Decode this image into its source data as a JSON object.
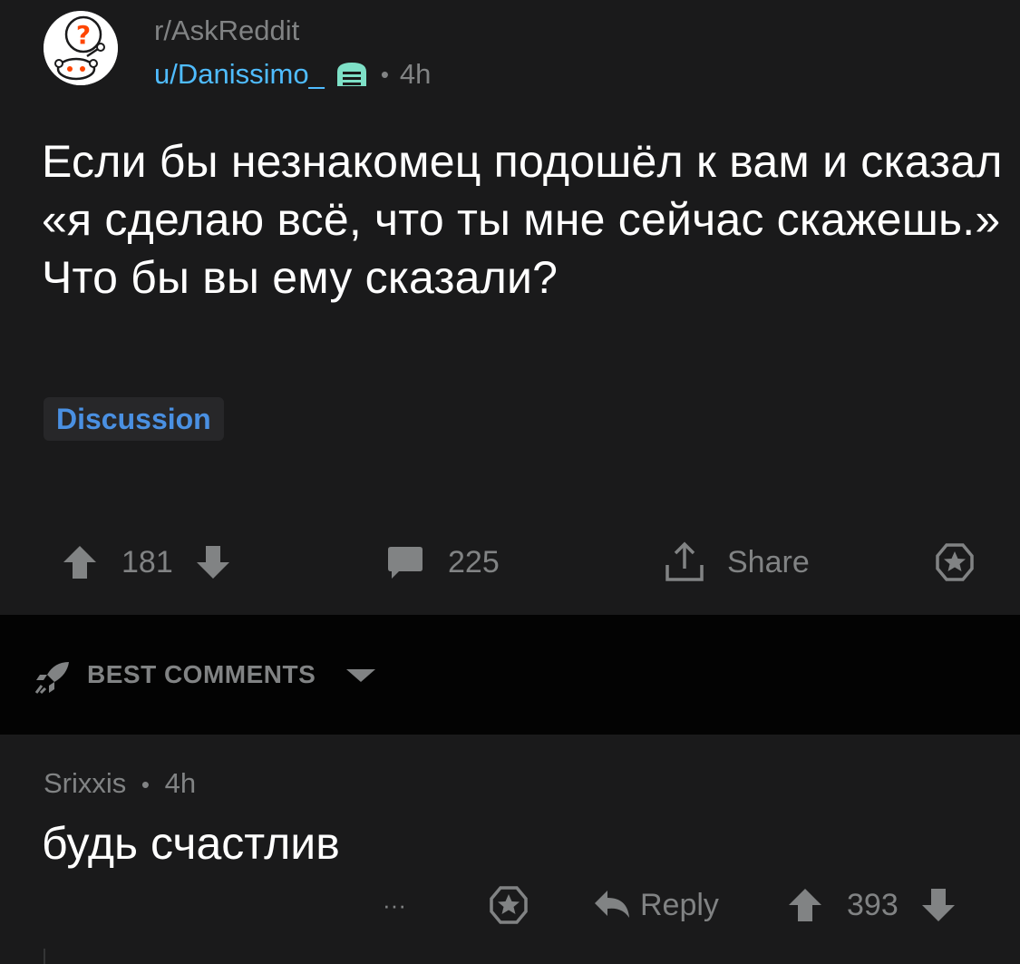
{
  "post": {
    "subreddit": "r/AskReddit",
    "username": "u/Danissimo_",
    "separator": "•",
    "time": "4h",
    "title": "Если бы незнакомец подошёл к вам и сказал «я сделаю всё, что ты мне сейчас скажешь.» Что бы вы ему сказали?",
    "flair": "Discussion",
    "upvotes": "181",
    "comments": "225",
    "share_label": "Share"
  },
  "sort": {
    "label": "BEST COMMENTS"
  },
  "comment": {
    "author": "Srixxis",
    "separator": "•",
    "time": "4h",
    "body": "будь счастлив",
    "more": "···",
    "reply_label": "Reply",
    "score": "393"
  },
  "colors": {
    "background": "#1a1a1b",
    "sort_bar": "#030303",
    "username": "#4fbcff",
    "flair": "#4a90e2",
    "muted": "#818384",
    "award": "#7ee0c7",
    "avatar_icon": "#ff4500"
  },
  "icons": [
    "askreddit-avatar-icon",
    "award-icon",
    "upvote-icon",
    "downvote-icon",
    "comment-icon",
    "share-icon",
    "gold-award-icon",
    "rocket-icon",
    "chevron-down-icon",
    "more-icon",
    "reply-icon"
  ]
}
